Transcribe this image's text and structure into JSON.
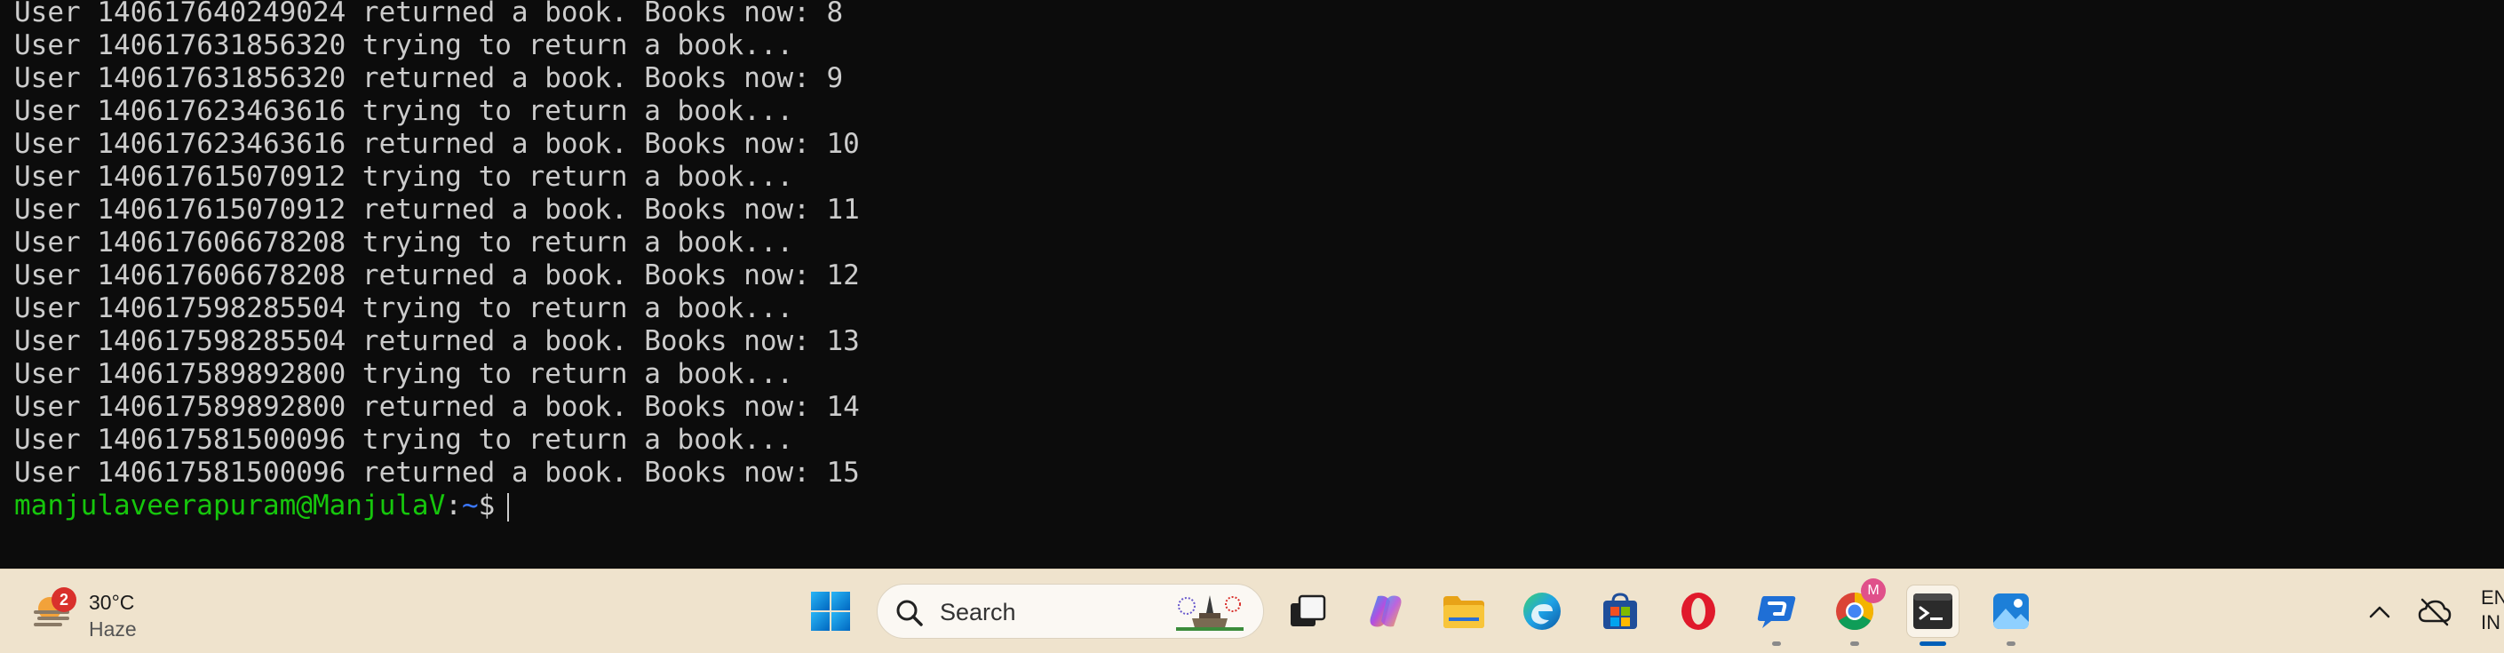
{
  "terminal": {
    "lines": [
      "User 140617640249024 returned a book. Books now: 8",
      "User 140617631856320 trying to return a book...",
      "User 140617631856320 returned a book. Books now: 9",
      "User 140617623463616 trying to return a book...",
      "User 140617623463616 returned a book. Books now: 10",
      "User 140617615070912 trying to return a book...",
      "User 140617615070912 returned a book. Books now: 11",
      "User 140617606678208 trying to return a book...",
      "User 140617606678208 returned a book. Books now: 12",
      "User 140617598285504 trying to return a book...",
      "User 140617598285504 returned a book. Books now: 13",
      "User 140617589892800 trying to return a book...",
      "User 140617589892800 returned a book. Books now: 14",
      "User 140617581500096 trying to return a book...",
      "User 140617581500096 returned a book. Books now: 15"
    ],
    "prompt": {
      "user_host": "manjulaveerapuram@ManjulaV",
      "colon": ":",
      "path": "~",
      "dollar": "$"
    },
    "colors": {
      "background": "#0c0c0c",
      "text": "#cccccc",
      "prompt_user": "#16c60c",
      "prompt_path": "#3b78ff"
    }
  },
  "taskbar": {
    "weather": {
      "badge": "2",
      "temperature": "30°C",
      "condition": "Haze",
      "icon": "weather-haze-icon"
    },
    "search": {
      "label": "Search",
      "icon": "search-icon"
    },
    "apps": [
      {
        "name": "start-button",
        "icon": "windows-logo-icon"
      },
      {
        "name": "task-view-button",
        "icon": "task-view-icon"
      },
      {
        "name": "copilot-app",
        "icon": "copilot-icon"
      },
      {
        "name": "file-explorer-app",
        "icon": "folder-icon"
      },
      {
        "name": "edge-app",
        "icon": "edge-icon"
      },
      {
        "name": "microsoft-store-app",
        "icon": "store-icon"
      },
      {
        "name": "opera-app",
        "icon": "opera-icon"
      },
      {
        "name": "chat-app",
        "icon": "chat-icon"
      },
      {
        "name": "chrome-app",
        "icon": "chrome-icon",
        "badge": "M"
      },
      {
        "name": "terminal-app",
        "icon": "terminal-icon",
        "active": true
      },
      {
        "name": "photos-app",
        "icon": "photos-icon"
      }
    ],
    "tray": {
      "language": "EN",
      "region": "IN"
    },
    "colors": {
      "background": "#efe3cd",
      "accent": "#005fb8"
    }
  }
}
